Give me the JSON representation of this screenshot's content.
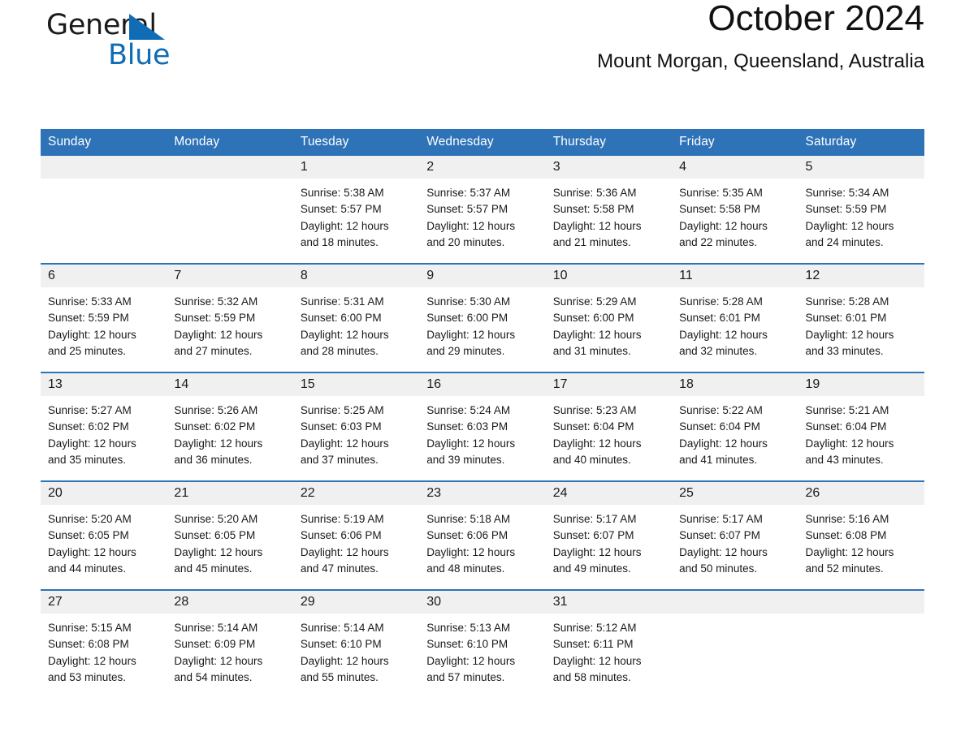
{
  "brand": {
    "name_part1": "General",
    "name_part2": "Blue",
    "accent_color": "#0f6cb5"
  },
  "header": {
    "month_title": "October 2024",
    "location": "Mount Morgan, Queensland, Australia",
    "header_bg_color": "#2e73b8",
    "daynum_bg_color": "#f0f0f0"
  },
  "weekday_headers": [
    "Sunday",
    "Monday",
    "Tuesday",
    "Wednesday",
    "Thursday",
    "Friday",
    "Saturday"
  ],
  "labels": {
    "sunrise_prefix": "Sunrise:",
    "sunset_prefix": "Sunset:",
    "daylight_prefix": "Daylight:"
  },
  "weeks": [
    [
      {
        "day": "",
        "sunrise": "",
        "sunset": "",
        "daylight_line1": "",
        "daylight_line2": ""
      },
      {
        "day": "",
        "sunrise": "",
        "sunset": "",
        "daylight_line1": "",
        "daylight_line2": ""
      },
      {
        "day": "1",
        "sunrise": "Sunrise: 5:38 AM",
        "sunset": "Sunset: 5:57 PM",
        "daylight_line1": "Daylight: 12 hours",
        "daylight_line2": "and 18 minutes."
      },
      {
        "day": "2",
        "sunrise": "Sunrise: 5:37 AM",
        "sunset": "Sunset: 5:57 PM",
        "daylight_line1": "Daylight: 12 hours",
        "daylight_line2": "and 20 minutes."
      },
      {
        "day": "3",
        "sunrise": "Sunrise: 5:36 AM",
        "sunset": "Sunset: 5:58 PM",
        "daylight_line1": "Daylight: 12 hours",
        "daylight_line2": "and 21 minutes."
      },
      {
        "day": "4",
        "sunrise": "Sunrise: 5:35 AM",
        "sunset": "Sunset: 5:58 PM",
        "daylight_line1": "Daylight: 12 hours",
        "daylight_line2": "and 22 minutes."
      },
      {
        "day": "5",
        "sunrise": "Sunrise: 5:34 AM",
        "sunset": "Sunset: 5:59 PM",
        "daylight_line1": "Daylight: 12 hours",
        "daylight_line2": "and 24 minutes."
      }
    ],
    [
      {
        "day": "6",
        "sunrise": "Sunrise: 5:33 AM",
        "sunset": "Sunset: 5:59 PM",
        "daylight_line1": "Daylight: 12 hours",
        "daylight_line2": "and 25 minutes."
      },
      {
        "day": "7",
        "sunrise": "Sunrise: 5:32 AM",
        "sunset": "Sunset: 5:59 PM",
        "daylight_line1": "Daylight: 12 hours",
        "daylight_line2": "and 27 minutes."
      },
      {
        "day": "8",
        "sunrise": "Sunrise: 5:31 AM",
        "sunset": "Sunset: 6:00 PM",
        "daylight_line1": "Daylight: 12 hours",
        "daylight_line2": "and 28 minutes."
      },
      {
        "day": "9",
        "sunrise": "Sunrise: 5:30 AM",
        "sunset": "Sunset: 6:00 PM",
        "daylight_line1": "Daylight: 12 hours",
        "daylight_line2": "and 29 minutes."
      },
      {
        "day": "10",
        "sunrise": "Sunrise: 5:29 AM",
        "sunset": "Sunset: 6:00 PM",
        "daylight_line1": "Daylight: 12 hours",
        "daylight_line2": "and 31 minutes."
      },
      {
        "day": "11",
        "sunrise": "Sunrise: 5:28 AM",
        "sunset": "Sunset: 6:01 PM",
        "daylight_line1": "Daylight: 12 hours",
        "daylight_line2": "and 32 minutes."
      },
      {
        "day": "12",
        "sunrise": "Sunrise: 5:28 AM",
        "sunset": "Sunset: 6:01 PM",
        "daylight_line1": "Daylight: 12 hours",
        "daylight_line2": "and 33 minutes."
      }
    ],
    [
      {
        "day": "13",
        "sunrise": "Sunrise: 5:27 AM",
        "sunset": "Sunset: 6:02 PM",
        "daylight_line1": "Daylight: 12 hours",
        "daylight_line2": "and 35 minutes."
      },
      {
        "day": "14",
        "sunrise": "Sunrise: 5:26 AM",
        "sunset": "Sunset: 6:02 PM",
        "daylight_line1": "Daylight: 12 hours",
        "daylight_line2": "and 36 minutes."
      },
      {
        "day": "15",
        "sunrise": "Sunrise: 5:25 AM",
        "sunset": "Sunset: 6:03 PM",
        "daylight_line1": "Daylight: 12 hours",
        "daylight_line2": "and 37 minutes."
      },
      {
        "day": "16",
        "sunrise": "Sunrise: 5:24 AM",
        "sunset": "Sunset: 6:03 PM",
        "daylight_line1": "Daylight: 12 hours",
        "daylight_line2": "and 39 minutes."
      },
      {
        "day": "17",
        "sunrise": "Sunrise: 5:23 AM",
        "sunset": "Sunset: 6:04 PM",
        "daylight_line1": "Daylight: 12 hours",
        "daylight_line2": "and 40 minutes."
      },
      {
        "day": "18",
        "sunrise": "Sunrise: 5:22 AM",
        "sunset": "Sunset: 6:04 PM",
        "daylight_line1": "Daylight: 12 hours",
        "daylight_line2": "and 41 minutes."
      },
      {
        "day": "19",
        "sunrise": "Sunrise: 5:21 AM",
        "sunset": "Sunset: 6:04 PM",
        "daylight_line1": "Daylight: 12 hours",
        "daylight_line2": "and 43 minutes."
      }
    ],
    [
      {
        "day": "20",
        "sunrise": "Sunrise: 5:20 AM",
        "sunset": "Sunset: 6:05 PM",
        "daylight_line1": "Daylight: 12 hours",
        "daylight_line2": "and 44 minutes."
      },
      {
        "day": "21",
        "sunrise": "Sunrise: 5:20 AM",
        "sunset": "Sunset: 6:05 PM",
        "daylight_line1": "Daylight: 12 hours",
        "daylight_line2": "and 45 minutes."
      },
      {
        "day": "22",
        "sunrise": "Sunrise: 5:19 AM",
        "sunset": "Sunset: 6:06 PM",
        "daylight_line1": "Daylight: 12 hours",
        "daylight_line2": "and 47 minutes."
      },
      {
        "day": "23",
        "sunrise": "Sunrise: 5:18 AM",
        "sunset": "Sunset: 6:06 PM",
        "daylight_line1": "Daylight: 12 hours",
        "daylight_line2": "and 48 minutes."
      },
      {
        "day": "24",
        "sunrise": "Sunrise: 5:17 AM",
        "sunset": "Sunset: 6:07 PM",
        "daylight_line1": "Daylight: 12 hours",
        "daylight_line2": "and 49 minutes."
      },
      {
        "day": "25",
        "sunrise": "Sunrise: 5:17 AM",
        "sunset": "Sunset: 6:07 PM",
        "daylight_line1": "Daylight: 12 hours",
        "daylight_line2": "and 50 minutes."
      },
      {
        "day": "26",
        "sunrise": "Sunrise: 5:16 AM",
        "sunset": "Sunset: 6:08 PM",
        "daylight_line1": "Daylight: 12 hours",
        "daylight_line2": "and 52 minutes."
      }
    ],
    [
      {
        "day": "27",
        "sunrise": "Sunrise: 5:15 AM",
        "sunset": "Sunset: 6:08 PM",
        "daylight_line1": "Daylight: 12 hours",
        "daylight_line2": "and 53 minutes."
      },
      {
        "day": "28",
        "sunrise": "Sunrise: 5:14 AM",
        "sunset": "Sunset: 6:09 PM",
        "daylight_line1": "Daylight: 12 hours",
        "daylight_line2": "and 54 minutes."
      },
      {
        "day": "29",
        "sunrise": "Sunrise: 5:14 AM",
        "sunset": "Sunset: 6:10 PM",
        "daylight_line1": "Daylight: 12 hours",
        "daylight_line2": "and 55 minutes."
      },
      {
        "day": "30",
        "sunrise": "Sunrise: 5:13 AM",
        "sunset": "Sunset: 6:10 PM",
        "daylight_line1": "Daylight: 12 hours",
        "daylight_line2": "and 57 minutes."
      },
      {
        "day": "31",
        "sunrise": "Sunrise: 5:12 AM",
        "sunset": "Sunset: 6:11 PM",
        "daylight_line1": "Daylight: 12 hours",
        "daylight_line2": "and 58 minutes."
      },
      {
        "day": "",
        "sunrise": "",
        "sunset": "",
        "daylight_line1": "",
        "daylight_line2": ""
      },
      {
        "day": "",
        "sunrise": "",
        "sunset": "",
        "daylight_line1": "",
        "daylight_line2": ""
      }
    ]
  ]
}
